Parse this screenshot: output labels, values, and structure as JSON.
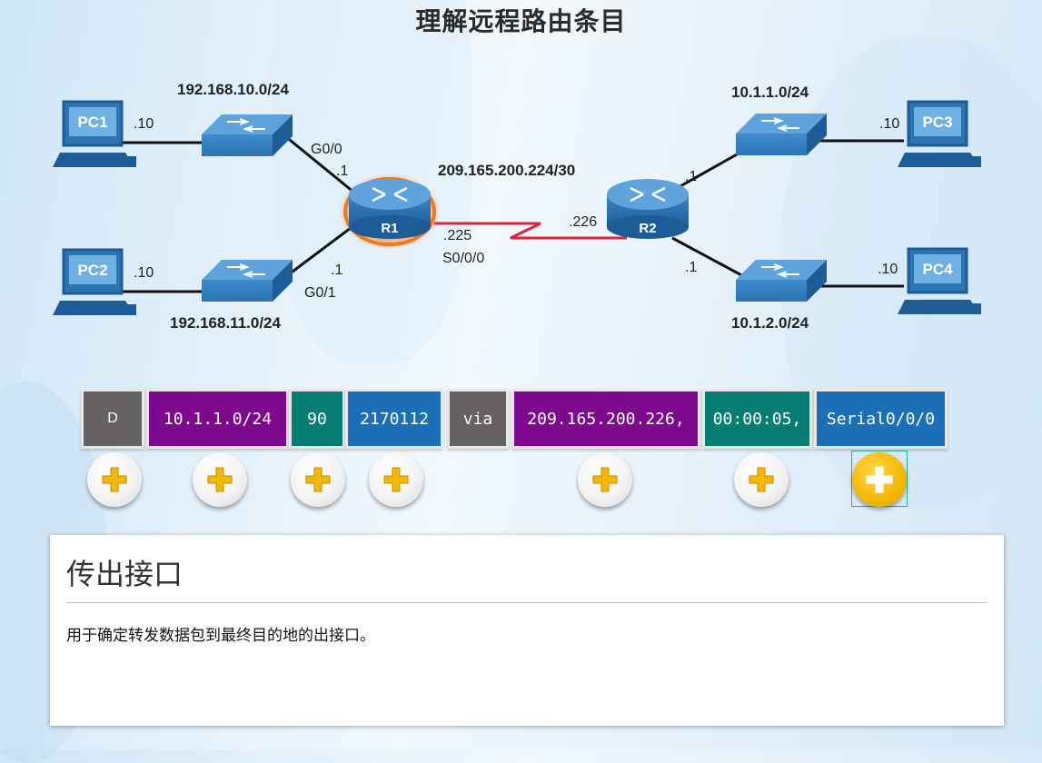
{
  "title": "理解远程路由条目",
  "topology": {
    "networks": {
      "lan1": "192.168.10.0/24",
      "lan2": "192.168.11.0/24",
      "lan3": "10.1.1.0/24",
      "lan4": "10.1.2.0/24",
      "wan": "209.165.200.224/30"
    },
    "devices": {
      "pc1": "PC1",
      "pc2": "PC2",
      "pc3": "PC3",
      "pc4": "PC4",
      "r1": "R1",
      "r2": "R2"
    },
    "interfaces": {
      "pc1_addr": ".10",
      "pc2_addr": ".10",
      "pc3_addr": ".10",
      "pc4_addr": ".10",
      "r1_g00": "G0/0",
      "r1_g00_addr": ".1",
      "r1_g01": "G0/1",
      "r1_g01_addr": ".1",
      "r1_s000_addr": ".225",
      "r1_s000": "S0/0/0",
      "r2_s_addr": ".226",
      "r2_top_addr": ".1",
      "r2_bottom_addr": ".1"
    }
  },
  "route_entry": {
    "fields": [
      {
        "id": "source",
        "text": "D",
        "color": "#666162"
      },
      {
        "id": "network",
        "text": "10.1.1.0/24",
        "color": "#7d0a8c"
      },
      {
        "id": "ad",
        "text": "90",
        "color": "#057d72"
      },
      {
        "id": "metric",
        "text": "2170112",
        "color": "#1a6fb6"
      },
      {
        "id": "via",
        "text": "via",
        "color": "#666162"
      },
      {
        "id": "next-hop",
        "text": "209.165.200.226,",
        "color": "#7d0a8c"
      },
      {
        "id": "time",
        "text": "00:00:05,",
        "color": "#057d72"
      },
      {
        "id": "interface",
        "text": "Serial0/0/0",
        "color": "#1a6fb6"
      }
    ],
    "hotspot_icon": "plus-icon",
    "active_hotspot": "interface"
  },
  "info_panel": {
    "title": "传出接口",
    "description": "用于确定转发数据包到最终目的地的出接口。"
  },
  "colors": {
    "router_glow": "#f07a1f",
    "serial_link": "#e0213f",
    "device_blue": "#1f6aa5",
    "hotspot_active": "#f5b800",
    "hotspot_frame": "#20b2a0"
  }
}
